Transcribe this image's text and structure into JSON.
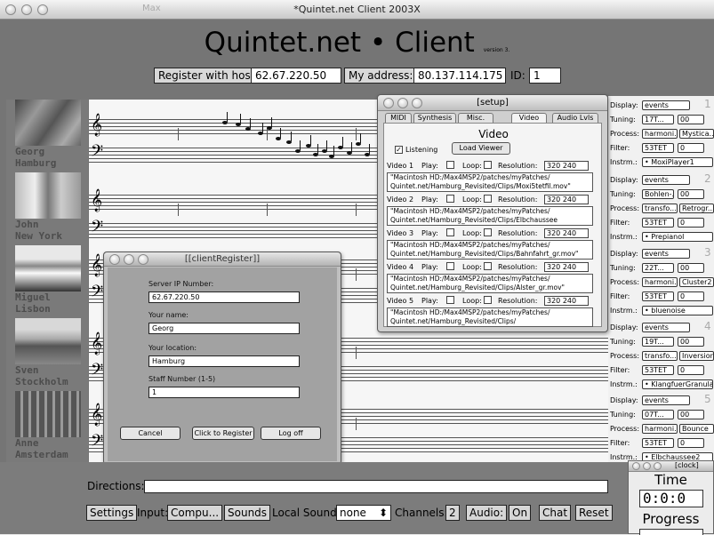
{
  "window": {
    "title": "*Quintet.net Client 2003X",
    "app_label": "Max"
  },
  "header": {
    "title": "Quintet.net • Client",
    "version": "version 3.",
    "register_button": "Register with host",
    "host_ip": "62.67.220.50",
    "my_address_label": "My address:",
    "my_address": "80.137.114.175",
    "id_label": "ID:",
    "id_value": "1"
  },
  "players": [
    {
      "first": "Georg",
      "city": "Hamburg"
    },
    {
      "first": "John",
      "city": "New York"
    },
    {
      "first": "Miguel",
      "city": "Lisbon"
    },
    {
      "first": "Sven",
      "city": "Stockholm"
    },
    {
      "first": "Anne",
      "city": "Amsterdam"
    }
  ],
  "right_panel": {
    "labels": {
      "display": "Display:",
      "tuning": "Tuning:",
      "process": "Process:",
      "filter": "Filter:",
      "instrm": "Instrm.:"
    },
    "staffs": [
      {
        "num": "1",
        "display": "events",
        "tuning": "17T...",
        "tuning_val": "00",
        "process_a": "harmoni...",
        "process_b": "Mystica...",
        "filter": "53TET",
        "filter_val": "0",
        "instrm": "• MoxiPlayer1"
      },
      {
        "num": "2",
        "display": "events",
        "tuning": "Bohlen-...",
        "tuning_val": "00",
        "process_a": "transfo...",
        "process_b": "Retrogr...",
        "filter": "53TET",
        "filter_val": "0",
        "instrm": "• Prepianol"
      },
      {
        "num": "3",
        "display": "events",
        "tuning": "22T...",
        "tuning_val": "00",
        "process_a": "harmoni...",
        "process_b": "Cluster2",
        "filter": "53TET",
        "filter_val": "0",
        "instrm": "• bluenoise"
      },
      {
        "num": "4",
        "display": "events",
        "tuning": "19T...",
        "tuning_val": "00",
        "process_a": "transfo...",
        "process_b": "Inversion",
        "filter": "53TET",
        "filter_val": "0",
        "instrm": "• KlangfuerGranular"
      },
      {
        "num": "5",
        "display": "events",
        "tuning": "07T...",
        "tuning_val": "00",
        "process_a": "harmoni...",
        "process_b": "Bounce",
        "filter": "53TET",
        "filter_val": "0",
        "instrm": "• Elbchaussee2"
      }
    ]
  },
  "setup": {
    "title": "[setup]",
    "tabs": [
      "MIDI",
      "Synthesis",
      "Misc.",
      "Video",
      "Audio Lvls"
    ],
    "section_title": "Video",
    "listening_label": "Listening",
    "load_viewer": "Load Viewer",
    "videos": [
      {
        "label": "Video 1",
        "play": "Play:",
        "loop": "Loop:",
        "resolution_label": "Resolution:",
        "resolution": "320 240",
        "path1": "\"Macintosh HD:/Max4MSP2/patches/myPatches/",
        "path2": "Quintet.net/Hamburg_Revisited/Clips/Moxi5tetfil.mov\""
      },
      {
        "label": "Video 2",
        "play": "Play:",
        "loop": "Loop:",
        "resolution_label": "Resolution:",
        "resolution": "320 240",
        "path1": "\"Macintosh HD:/Max4MSP2/patches/myPatches/",
        "path2": "Quintet.net/Hamburg_Revisited/Clips/Elbchaussee"
      },
      {
        "label": "Video 3",
        "play": "Play:",
        "loop": "Loop:",
        "resolution_label": "Resolution:",
        "resolution": "320 240",
        "path1": "\"Macintosh HD:/Max4MSP2/patches/myPatches/",
        "path2": "Quintet.net/Hamburg_Revisited/Clips/Bahnfahrt_gr.mov\""
      },
      {
        "label": "Video 4",
        "play": "Play:",
        "loop": "Loop:",
        "resolution_label": "Resolution:",
        "resolution": "320 240",
        "path1": "\"Macintosh HD:/Max4MSP2/patches/myPatches/",
        "path2": "Quintet.net/Hamburg_Revisited/Clips/Alster_gr.mov\""
      },
      {
        "label": "Video 5",
        "play": "Play:",
        "loop": "Loop:",
        "resolution_label": "Resolution:",
        "resolution": "320 240",
        "path1": "\"Macintosh HD:/Max4MSP2/patches/myPatches/",
        "path2": "Quintet.net/Hamburg_Revisited/Clips/"
      }
    ]
  },
  "client_register": {
    "title": "[[clientRegister]]",
    "server_ip_label": "Server IP Number:",
    "server_ip": "62.67.220.50",
    "name_label": "Your name:",
    "name": "Georg",
    "location_label": "Your location:",
    "location": "Hamburg",
    "staff_label": "Staff Number (1-5)",
    "staff": "1",
    "cancel": "Cancel",
    "register": "Click to Register",
    "logoff": "Log off"
  },
  "bottom": {
    "directions_label": "Directions:",
    "settings": "Settings",
    "input_label": "Input:",
    "input_value": "Compu...",
    "sounds": "Sounds",
    "local_sound_label": "Local Sound:",
    "local_sound_value": "none",
    "channels_label": "Channels:",
    "channels_value": "2",
    "audio_label": "Audio:",
    "audio_value": "On",
    "chat": "Chat",
    "reset": "Reset"
  },
  "clock": {
    "title": "[clock]",
    "time_label": "Time",
    "time": "0:0:0",
    "progress_label": "Progress"
  }
}
